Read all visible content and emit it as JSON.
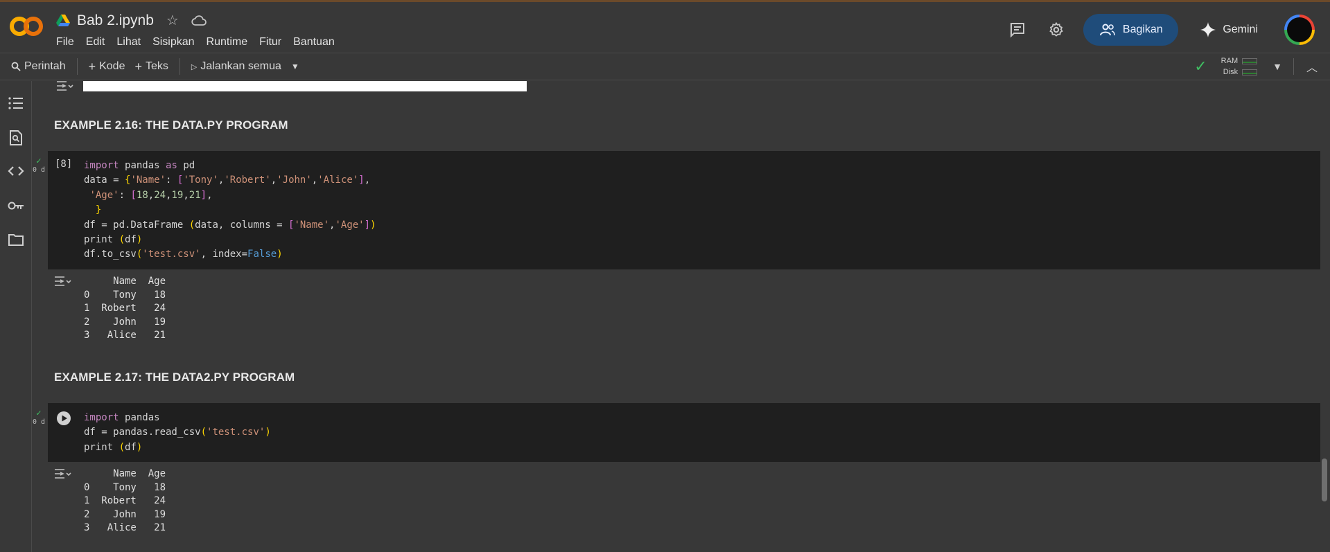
{
  "app": {
    "title": "Bab 2.ipynb",
    "menu": [
      "File",
      "Edit",
      "Lihat",
      "Sisipkan",
      "Runtime",
      "Fitur",
      "Bantuan"
    ],
    "share_label": "Bagikan",
    "gemini_label": "Gemini"
  },
  "toolbar": {
    "commands_label": "Perintah",
    "code_label": "Kode",
    "text_label": "Teks",
    "run_all_label": "Jalankan semua",
    "ram_label": "RAM",
    "disk_label": "Disk"
  },
  "cells": [
    {
      "heading": "EXAMPLE 2.16: THE DATA.PY PROGRAM",
      "exec_count": "[8]",
      "time": "0 d",
      "output_header": "     Name  Age",
      "output_rows": [
        "0    Tony   18",
        "1  Robert   24",
        "2    John   19",
        "3   Alice   21"
      ]
    },
    {
      "heading": "EXAMPLE 2.17: THE DATA2.PY PROGRAM",
      "time": "0 d",
      "output_header": "     Name  Age",
      "output_rows": [
        "0    Tony   18",
        "1  Robert   24",
        "2    John   19",
        "3   Alice   21"
      ]
    }
  ],
  "code_tokens": {
    "import": "import",
    "pandas": "pandas",
    "as": "as",
    "pd": "pd",
    "data_assign": "data = ",
    "name_key": "'Name'",
    "colon_space": ": ",
    "tony": "'Tony'",
    "robert": "'Robert'",
    "john": "'John'",
    "alice": "'Alice'",
    "age_key": "'Age'",
    "n18": "18",
    "n24": "24",
    "n19": "19",
    "n21": "21",
    "df_assign": "df = pd.DataFrame ",
    "columns_kw": "data, columns = ",
    "print_fn": "print ",
    "df_arg": "df",
    "to_csv": "df.to_csv",
    "test_csv": "'test.csv'",
    "index_kw": ", index=",
    "false": "False",
    "read_csv_assign": "df = pandas.read_csv"
  },
  "colors": {
    "accent": "#1f4c7a",
    "success": "#3fbf62",
    "keyword": "#c586c0",
    "string": "#ce9178",
    "number": "#b5cea8",
    "boolean": "#569cd6",
    "bracket": "#ffd700"
  }
}
